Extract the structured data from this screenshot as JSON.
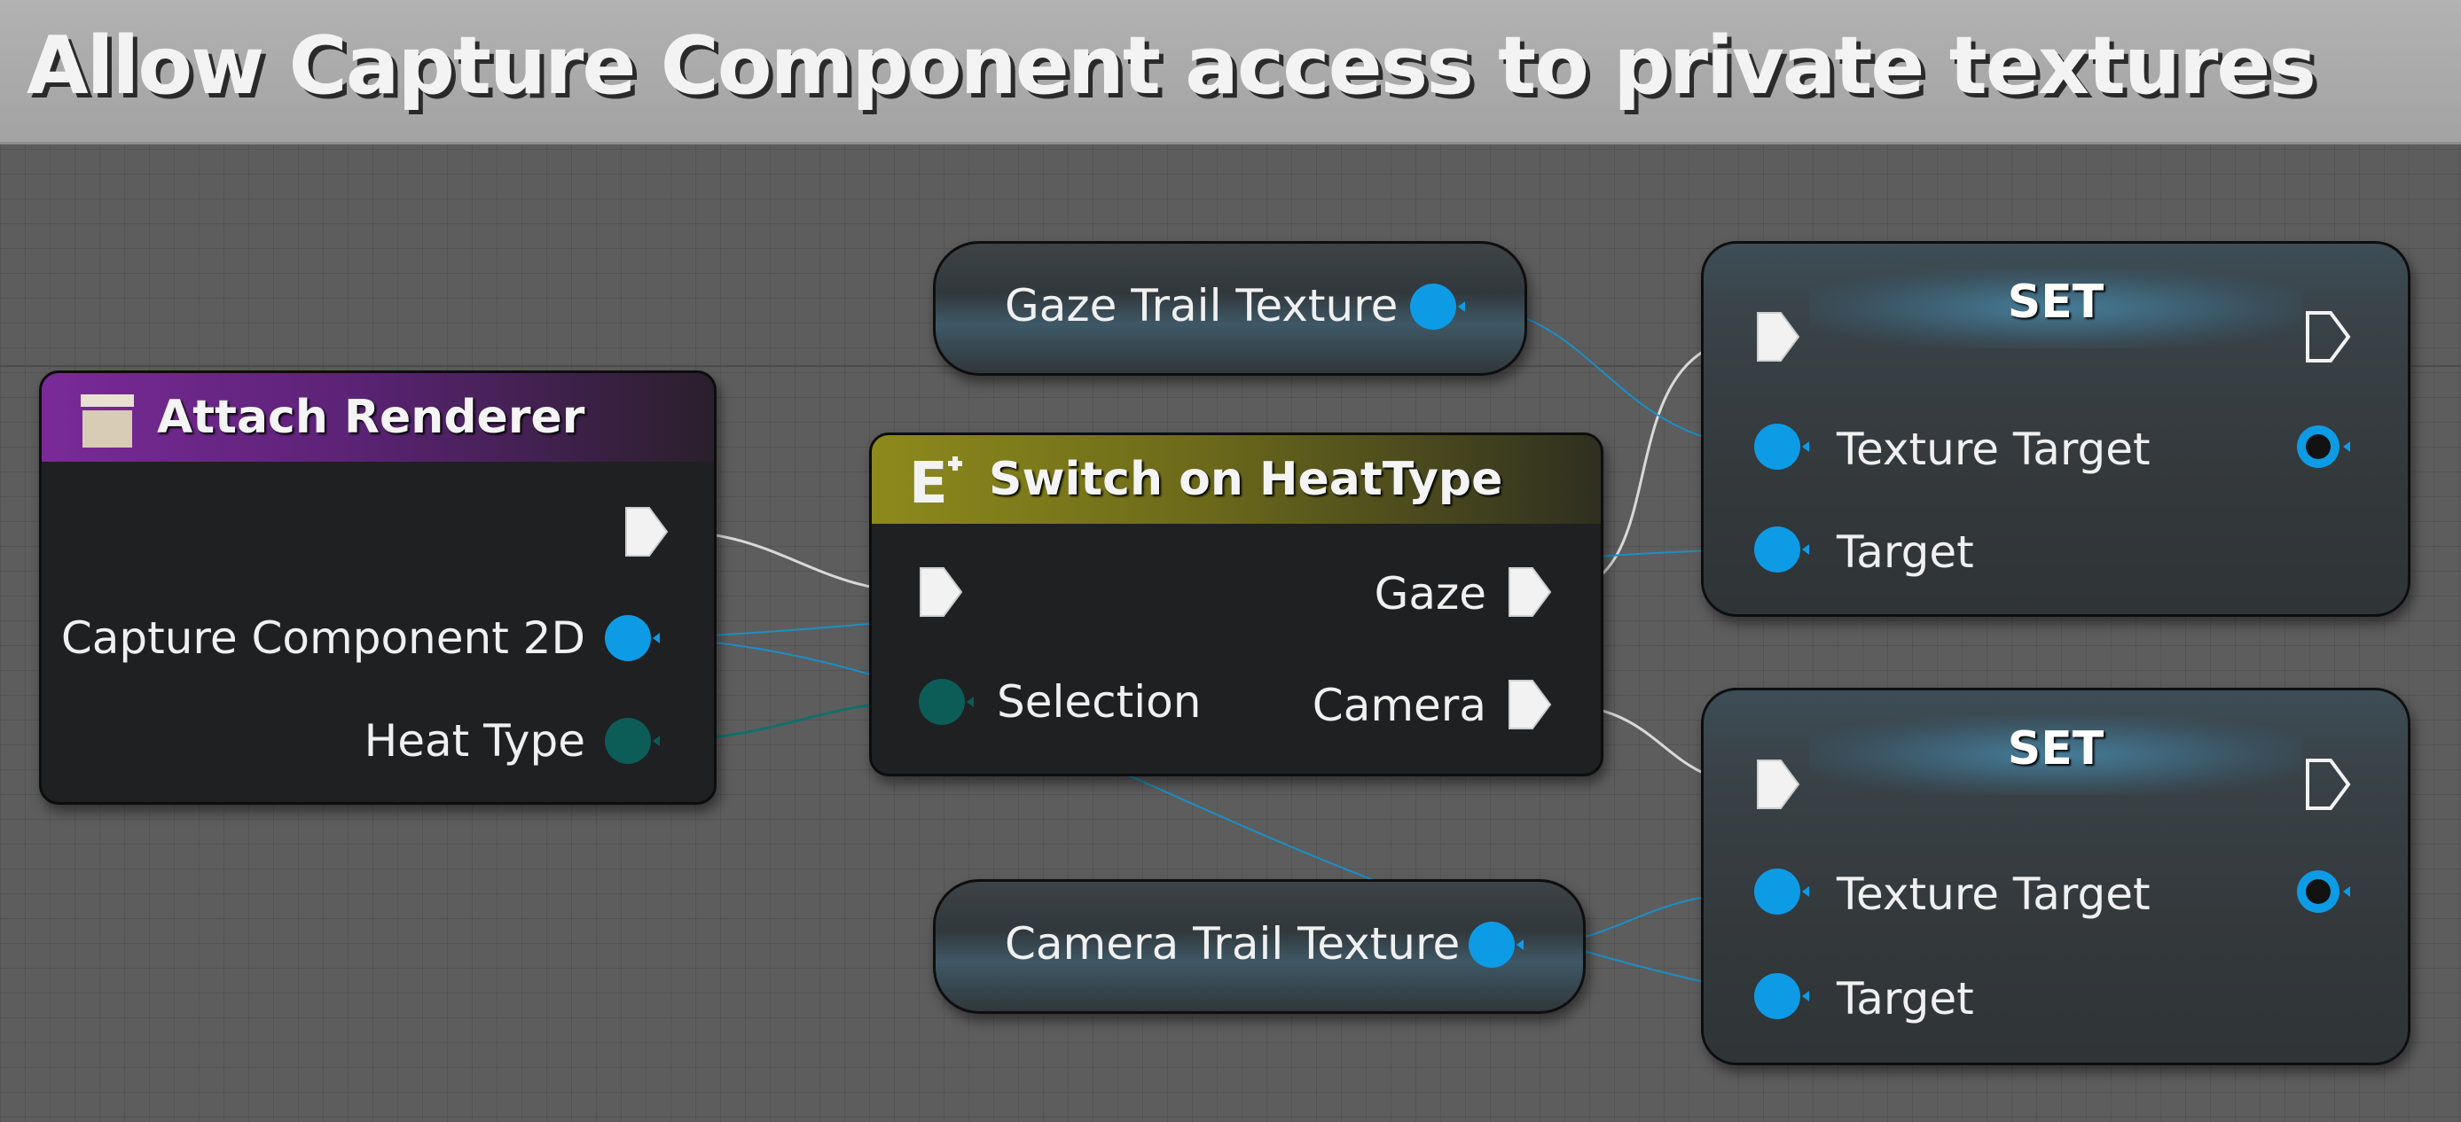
{
  "comment": {
    "title": "Allow Capture Component access to private textures"
  },
  "attach_renderer": {
    "title": "Attach Renderer",
    "pins": {
      "capture_component": "Capture Component 2D",
      "heat_type": "Heat Type"
    }
  },
  "switch_node": {
    "title": "Switch on HeatType",
    "pins": {
      "selection": "Selection",
      "gaze": "Gaze",
      "camera": "Camera"
    }
  },
  "gaze_texture_var": {
    "label": "Gaze Trail Texture"
  },
  "camera_texture_var": {
    "label": "Camera Trail Texture"
  },
  "set_nodes": [
    {
      "title": "SET",
      "texture_target": "Texture Target",
      "target": "Target"
    },
    {
      "title": "SET",
      "texture_target": "Texture Target",
      "target": "Target"
    }
  ],
  "colors": {
    "object_pin": "#0d9be5",
    "enum_pin": "#0c5c58",
    "exec_pin": "#f2f2f2",
    "function_header": "#7a2a98",
    "switch_header": "#8d8a1c"
  }
}
